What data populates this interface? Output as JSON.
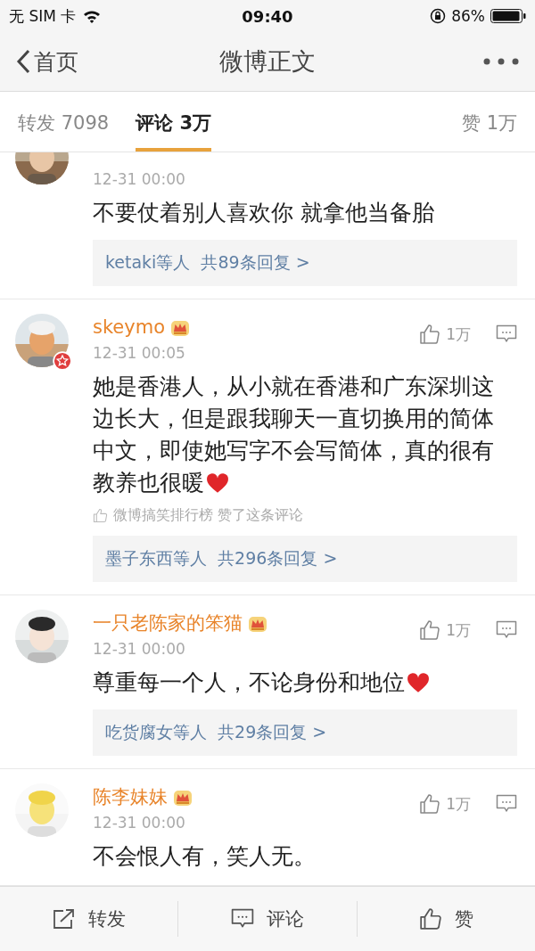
{
  "status_bar": {
    "carrier": "无 SIM 卡",
    "time": "09:40",
    "battery": "86%"
  },
  "nav": {
    "back": "首页",
    "title": "微博正文"
  },
  "tabs": [
    {
      "label": "转发 7098",
      "selected": false
    },
    {
      "label": "评论 3万",
      "selected": true
    },
    {
      "label": "赞 1万",
      "selected": false
    }
  ],
  "comments": [
    {
      "partial": true,
      "time": "12-31 00:00",
      "text": "不要仗着别人喜欢你 就拿他当备胎",
      "heart": false,
      "replies": "ketaki等人  共89条回复 >"
    },
    {
      "name": "skeymo",
      "vip": true,
      "verified": true,
      "time": "12-31 00:05",
      "likes": "1万",
      "text": "她是香港人，从小就在香港和广东深圳这边长大，但是跟我聊天一直切换用的简体中文，即使她写字不会写简体，真的很有教养也很暖",
      "heart": true,
      "liked_by": "微博搞笑排行榜 赞了这条评论",
      "replies": "墨子东西等人  共296条回复 >"
    },
    {
      "name": "一只老陈家的笨猫",
      "vip": true,
      "verified": false,
      "time": "12-31 00:00",
      "likes": "1万",
      "text": "尊重每一个人，不论身份和地位",
      "heart": true,
      "replies": "吃货腐女等人  共29条回复 >"
    },
    {
      "name": "陈李妹妹",
      "vip": true,
      "verified": false,
      "time": "12-31 00:00",
      "likes": "1万",
      "text": "不会恨人有，笑人无。",
      "heart": false
    }
  ],
  "bottom_bar": [
    {
      "kind": "repost",
      "label": "转发"
    },
    {
      "kind": "comment",
      "label": "评论"
    },
    {
      "kind": "like",
      "label": "赞"
    }
  ]
}
